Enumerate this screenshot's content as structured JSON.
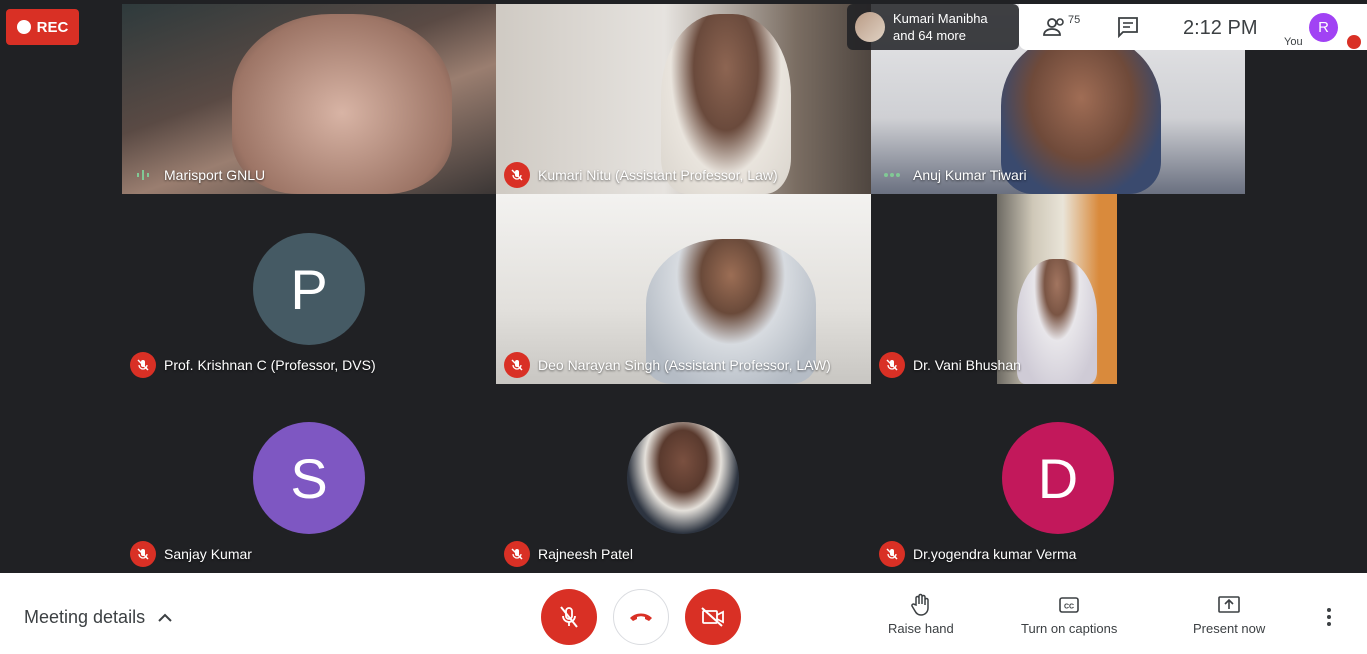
{
  "recording": {
    "label": "REC"
  },
  "others": {
    "name": "Kumari Manibha",
    "more": "and 64 more"
  },
  "topbar": {
    "participant_count": "75",
    "time": "2:12 PM"
  },
  "you": {
    "label": "You",
    "initial": "R"
  },
  "tiles": [
    {
      "name": "Marisport GNLU",
      "status": "speaking"
    },
    {
      "name": "Kumari Nitu (Assistant Professor, Law)",
      "status": "muted"
    },
    {
      "name": "Anuj Kumar Tiwari",
      "status": "speaking"
    },
    {
      "name": "Prof. Krishnan C (Professor, DVS)",
      "status": "muted",
      "initial": "P"
    },
    {
      "name": "Deo Narayan Singh (Assistant Professor, LAW)",
      "status": "muted"
    },
    {
      "name": "Dr. Vani Bhushan",
      "status": "muted"
    },
    {
      "name": "Sanjay Kumar",
      "status": "muted",
      "initial": "S"
    },
    {
      "name": "Rajneesh Patel",
      "status": "muted"
    },
    {
      "name": "Dr.yogendra kumar Verma",
      "status": "muted",
      "initial": "D"
    }
  ],
  "bottombar": {
    "meeting_details": "Meeting details",
    "raise_hand": "Raise hand",
    "captions": "Turn on captions",
    "present": "Present now"
  },
  "colors": {
    "muted_red": "#d93025",
    "avatar_p": "#455a64",
    "avatar_s": "#7e57c2",
    "avatar_d": "#c2185b",
    "you_avatar": "#a142f4"
  }
}
